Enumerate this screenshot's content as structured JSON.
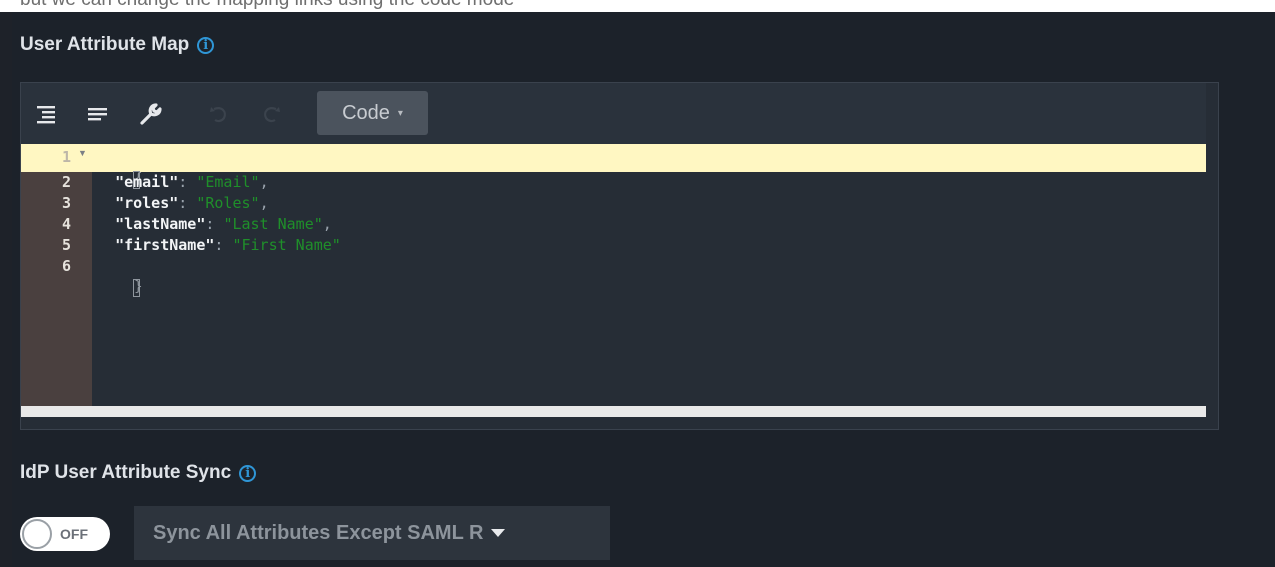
{
  "top_hint": "but we can change the mapping links using the code mode",
  "user_attribute_map": {
    "label": "User Attribute Map",
    "info_icon": "info-icon",
    "toolbar": {
      "icons": [
        "format-icon",
        "compact-icon",
        "wrench-icon",
        "undo-icon",
        "redo-icon"
      ],
      "mode_label": "Code",
      "mode_caret": "▾"
    },
    "editor": {
      "line_numbers": [
        "1",
        "2",
        "3",
        "4",
        "5",
        "6"
      ],
      "lines": [
        {
          "key": "\"email\"",
          "value": "\"Email\"",
          "trailing": ","
        },
        {
          "key": "\"roles\"",
          "value": "\"Roles\"",
          "trailing": ","
        },
        {
          "key": "\"lastName\"",
          "value": "\"Last Name\"",
          "trailing": ","
        },
        {
          "key": "\"firstName\"",
          "value": "\"First Name\"",
          "trailing": ""
        }
      ]
    }
  },
  "idp_sync": {
    "label": "IdP User Attribute Sync",
    "toggle_state": "OFF",
    "select_value": "Sync All Attributes Except SAML R"
  },
  "colors": {
    "background": "#1e2229",
    "accent": "#2f96d6",
    "active_line": "#fff7c2",
    "string": "#1f8f2a"
  }
}
